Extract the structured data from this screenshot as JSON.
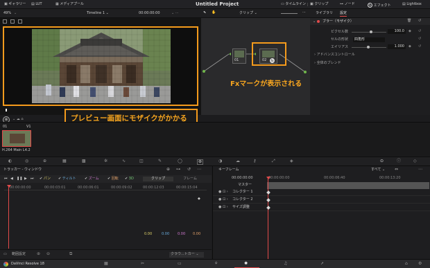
{
  "topbar": {
    "gallery": "ギャラリー",
    "lut": "LUT",
    "media_pool": "メディアプール",
    "project_title": "Untitled Project",
    "timeline_tab": "タイムライン",
    "clips_tab": "クリップ",
    "nodes_tab": "ノード",
    "effects_tab": "エフェクト",
    "lightbox_tab": "Lightbox"
  },
  "subbar": {
    "zoom": "49%",
    "timeline_name": "Timeline 1",
    "timecode": "00:00:00:00",
    "clip_mode": "クリップ",
    "library_tab": "ライブラリ",
    "settings_tab": "設定"
  },
  "inspector": {
    "effect_name": "ブラー（モザイク）",
    "pixel_freq_label": "ピクセル数",
    "pixel_freq_value": "100.0",
    "cell_shape_label": "セルの形状",
    "cell_shape_value": "四角形",
    "aspect_label": "エイリアス",
    "aspect_value": "1.000",
    "advanced_controls": "アドバンスコントロール",
    "global_blend": "全体のブレンド"
  },
  "nodes": {
    "node1_label": "01",
    "node2_label": "02",
    "fx_badge": "fx"
  },
  "callouts": {
    "preview": "プレビュー画面にモザイクがかかる",
    "fx_mark": "Fxマークが表示される"
  },
  "clips": {
    "clip_number": "01",
    "track": "V1",
    "codec": "H.264 Main L4.2"
  },
  "tracker": {
    "title": "トラッカー - ウィンドウ",
    "opt_pan": "パン",
    "opt_tilt": "ティルト",
    "opt_zoom": "ズーム",
    "opt_rotate": "回転",
    "opt_3d": "3D",
    "clip_btn": "クリップ",
    "frame_btn": "フレーム",
    "ruler": [
      "00:00:00:00",
      "00:00:03:01",
      "00:00:06:01",
      "00:00:09:02",
      "00:00:12:03",
      "00:00:15:04"
    ],
    "values": [
      "0.00",
      "0.00",
      "0.00",
      "0.00"
    ],
    "range_label": "範囲設定",
    "mode_select": "クラウ...トカー"
  },
  "keyframes": {
    "title": "キーフレーム",
    "filter": "すべて",
    "timecodes": [
      "00:00:00:00",
      "00:00:06:40",
      "00:00:13:20"
    ],
    "master": "マスター",
    "rows": [
      "コレクター 1",
      "コレクター 2",
      "サイズ調整"
    ]
  },
  "bottombar": {
    "app_name": "DaVinci Resolve 18"
  },
  "colors": {
    "accent": "#f59b1c",
    "playhead": "#e34a4a"
  }
}
